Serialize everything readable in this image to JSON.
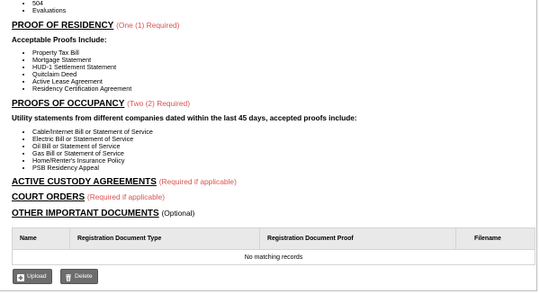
{
  "top_list": [
    "504",
    "Evaluations"
  ],
  "residency": {
    "title": "PROOF OF RESIDENCY",
    "requirement": "(One (1) Required)",
    "subhead": "Acceptable Proofs Include:",
    "items": [
      "Property Tax Bill",
      "Mortgage Statement",
      "HUD-1 Settlement Statement",
      "Quitclaim Deed",
      "Active Lease Agreement",
      "Residency Certification Agreement"
    ]
  },
  "occupancy": {
    "title": "PROOFS OF OCCUPANCY",
    "requirement": "(Two (2) Required)",
    "subhead": "Utility statements from different companies dated within the last 45 days, accepted proofs include:",
    "items": [
      "Cable/Internet Bill or Statement of Service",
      "Electric Bill or Statement of Service",
      "Oil Bill or Statement of Service",
      "Gas Bill or Statement of Service",
      "Home/Renter's Insurance Policy",
      "PSB Residency Appeal"
    ]
  },
  "custody": {
    "title": "ACTIVE CUSTODY AGREEMENTS",
    "requirement": "(Required if applicable)"
  },
  "court": {
    "title": "COURT ORDERS",
    "requirement": "(Required if applicable)"
  },
  "other": {
    "title": "OTHER IMPORTANT DOCUMENTS",
    "note": "(Optional)"
  },
  "table": {
    "columns": [
      "Name",
      "Registration Document Type",
      "Registration Document Proof",
      "Filename"
    ],
    "empty_message": "No matching records"
  },
  "buttons": {
    "upload_label": "Upload",
    "delete_label": "Delete"
  },
  "icons": {
    "upload": "upload-icon",
    "delete": "trash-icon"
  },
  "colors": {
    "required_text": "#d9534f",
    "button_bg": "#6d6d6d",
    "table_header_bg": "#e9e9e9"
  }
}
